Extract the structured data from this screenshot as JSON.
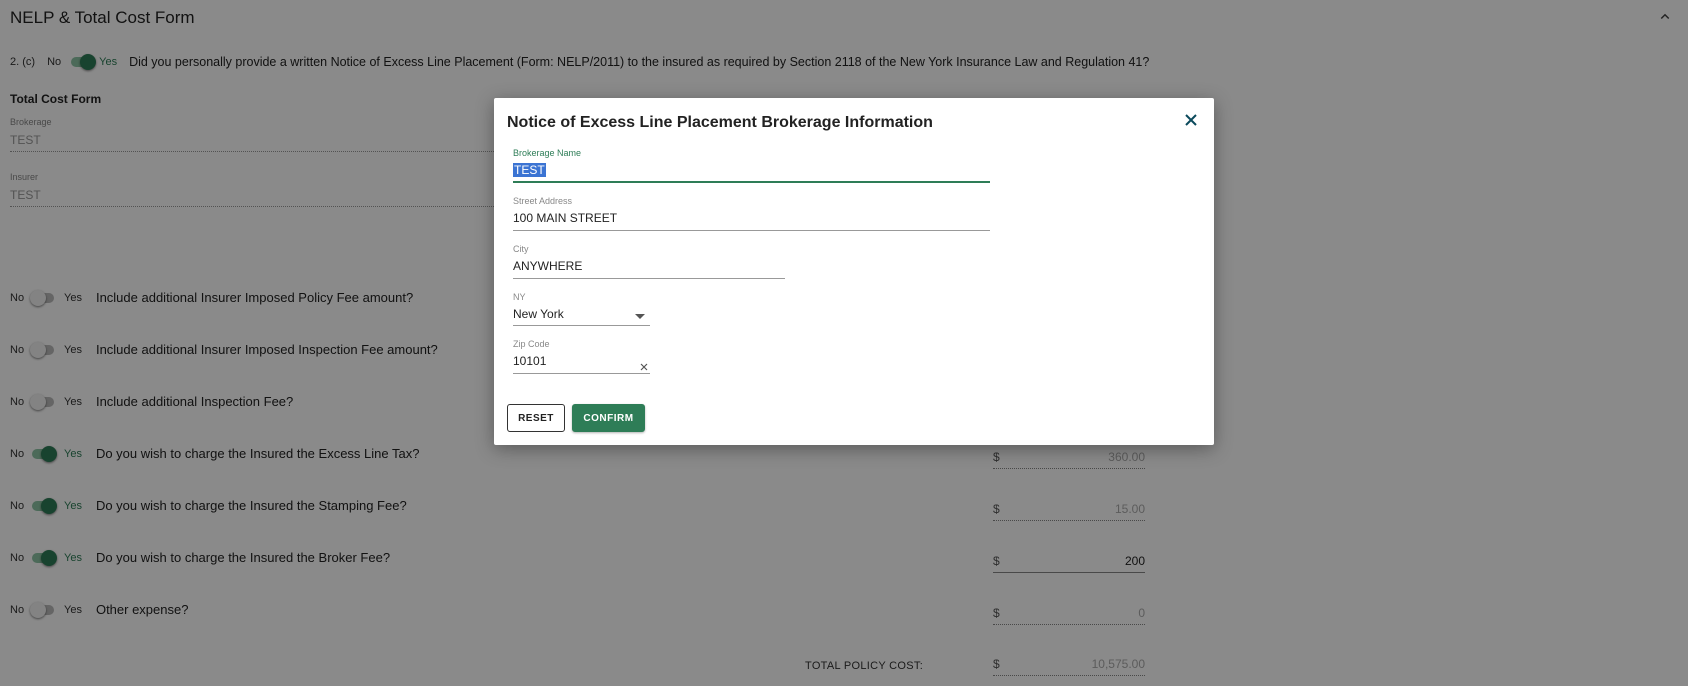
{
  "section": {
    "title": "NELP & Total Cost Form"
  },
  "question_2c": {
    "number": "2. (c)",
    "no": "No",
    "yes": "Yes",
    "text": "Did you personally provide a written Notice of Excess Line Placement (Form: NELP/2011) to the insured as required by Section 2118 of the New York Insurance Law and Regulation 41?",
    "enabled": true
  },
  "total_cost_form": {
    "title": "Total Cost Form",
    "brokerage_label": "Brokerage",
    "brokerage_value": "TEST",
    "insurer_label": "Insurer",
    "insurer_value": "TEST"
  },
  "fee_questions": [
    {
      "no": "No",
      "yes": "Yes",
      "text": "Include additional Insurer Imposed Policy Fee amount?",
      "enabled": false
    },
    {
      "no": "No",
      "yes": "Yes",
      "text": "Include additional Insurer Imposed Inspection Fee amount?",
      "enabled": false
    },
    {
      "no": "No",
      "yes": "Yes",
      "text": "Include additional Inspection Fee?",
      "enabled": false
    },
    {
      "no": "No",
      "yes": "Yes",
      "text": "Do you wish to charge the Insured the Excess Line Tax?",
      "enabled": true
    },
    {
      "no": "No",
      "yes": "Yes",
      "text": "Do you wish to charge the Insured the Stamping Fee?",
      "enabled": true
    },
    {
      "no": "No",
      "yes": "Yes",
      "text": "Do you wish to charge the Insured the Broker Fee?",
      "enabled": true
    },
    {
      "no": "No",
      "yes": "Yes",
      "text": "Other expense?",
      "enabled": false
    }
  ],
  "amounts": {
    "currency": "$",
    "excess_line_tax": "360.00",
    "stamping_fee": "15.00",
    "broker_fee": "200",
    "other_expense": "0",
    "total_label": "TOTAL POLICY COST:",
    "total_value": "10,575.00"
  },
  "modal": {
    "title": "Notice of Excess Line Placement Brokerage Information",
    "brokerage_name_label": "Brokerage Name",
    "brokerage_name_value": "TEST",
    "street_label": "Street Address",
    "street_value": "100 MAIN STREET",
    "city_label": "City",
    "city_value": "ANYWHERE",
    "state_label": "NY",
    "state_value": "New York",
    "zip_label": "Zip Code",
    "zip_value": "10101",
    "reset_label": "RESET",
    "confirm_label": "CONFIRM"
  },
  "icons": {
    "collapse": "chevron-up-icon",
    "close": "close-icon",
    "clear": "clear-icon",
    "dropdown": "dropdown-arrow-icon"
  },
  "colors": {
    "accent": "#2e7d57",
    "selection": "#3b74d3",
    "overlay": "rgba(0,0,0,0.46)"
  }
}
